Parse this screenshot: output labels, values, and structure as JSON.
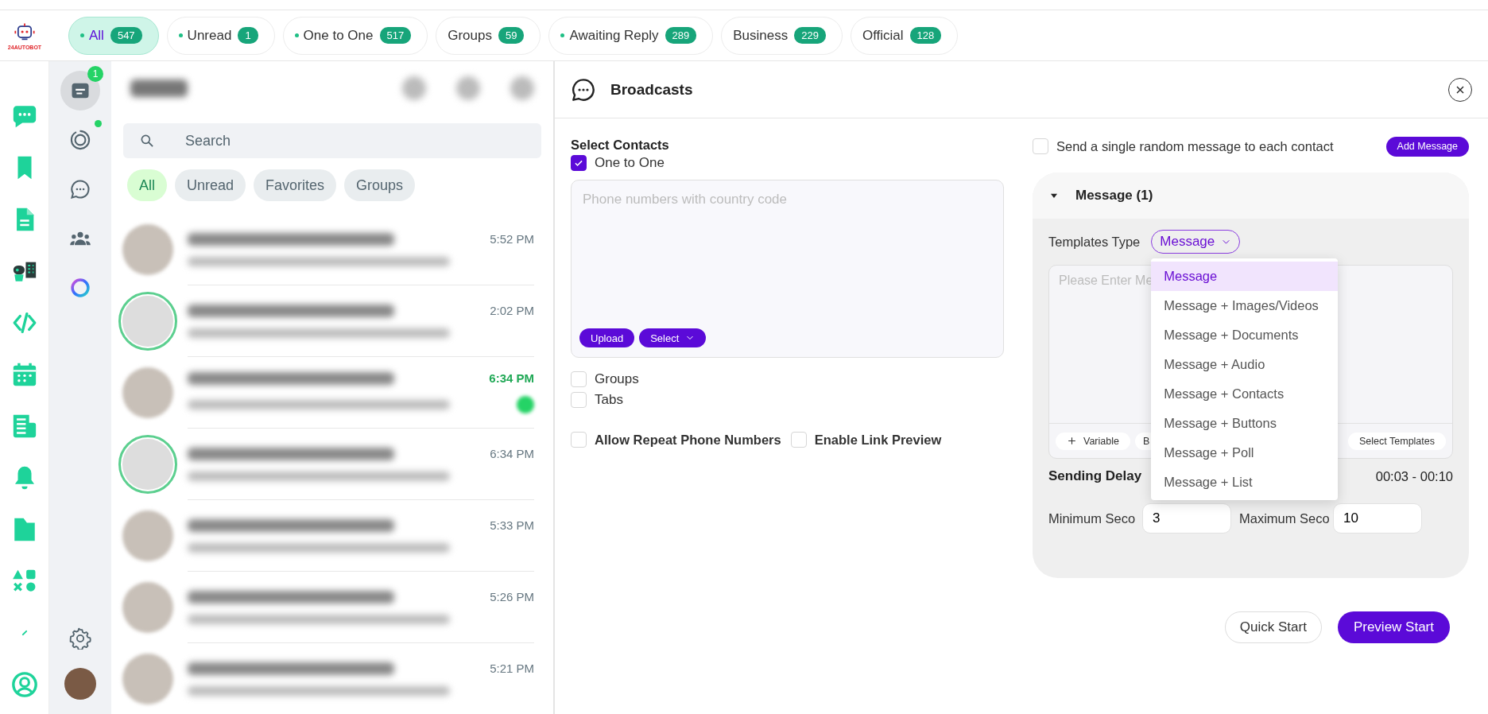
{
  "logo": {
    "text": "24AUTOBOT"
  },
  "filter_tabs": [
    {
      "label": "All",
      "count": "547",
      "dot": true,
      "selected": true
    },
    {
      "label": "Unread",
      "count": "1",
      "dot": true,
      "selected": false
    },
    {
      "label": "One to One",
      "count": "517",
      "dot": true,
      "selected": false
    },
    {
      "label": "Groups",
      "count": "59",
      "dot": false,
      "selected": false
    },
    {
      "label": "Awaiting Reply",
      "count": "289",
      "dot": true,
      "selected": false
    },
    {
      "label": "Business",
      "count": "229",
      "dot": false,
      "selected": false
    },
    {
      "label": "Official",
      "count": "128",
      "dot": false,
      "selected": false
    }
  ],
  "nav_rail": [
    {
      "kind": "chat"
    },
    {
      "kind": "bookmark"
    },
    {
      "kind": "document"
    },
    {
      "kind": "robot"
    },
    {
      "kind": "code"
    },
    {
      "kind": "calendar"
    },
    {
      "kind": "newspaper"
    },
    {
      "kind": "bell"
    },
    {
      "kind": "folder"
    },
    {
      "kind": "shapes"
    },
    {
      "kind": "slash"
    },
    {
      "kind": "user"
    }
  ],
  "side_rail": {
    "items": [
      {
        "kind": "chats",
        "selected": true,
        "dot": false,
        "badge": "1"
      },
      {
        "kind": "status",
        "selected": false,
        "dot": true
      },
      {
        "kind": "channels",
        "selected": false,
        "dot": false
      },
      {
        "kind": "communities",
        "selected": false,
        "dot": false
      },
      {
        "kind": "ai",
        "selected": false,
        "dot": false
      }
    ],
    "bottom": [
      {
        "kind": "settings"
      },
      {
        "kind": "profile"
      }
    ]
  },
  "chat_list": {
    "search": {
      "placeholder": "Search"
    },
    "chips": [
      {
        "label": "All",
        "selected": true
      },
      {
        "label": "Unread",
        "selected": false
      },
      {
        "label": "Favorites",
        "selected": false
      },
      {
        "label": "Groups",
        "selected": false
      }
    ],
    "rows": [
      {
        "time": "5:52 PM",
        "unread": false,
        "status_ring": false
      },
      {
        "time": "2:02 PM",
        "unread": false,
        "status_ring": true
      },
      {
        "time": "6:34 PM",
        "unread": true,
        "status_ring": false
      },
      {
        "time": "6:34 PM",
        "unread": false,
        "status_ring": true
      },
      {
        "time": "5:33 PM",
        "unread": false,
        "status_ring": false
      },
      {
        "time": "5:26 PM",
        "unread": false,
        "status_ring": false
      },
      {
        "time": "5:21 PM",
        "unread": false,
        "status_ring": false
      }
    ]
  },
  "broadcast": {
    "title": "Broadcasts",
    "contacts": {
      "heading": "Select Contacts",
      "one_to_one": {
        "label": "One to One",
        "checked": true
      },
      "phone_field": {
        "placeholder": "Phone numbers with country code"
      },
      "buttons": {
        "upload": "Upload",
        "select": "Select"
      },
      "others": [
        {
          "label": "Groups",
          "checked": false
        },
        {
          "label": "Tabs",
          "checked": false
        }
      ],
      "options": [
        {
          "label": "Allow Repeat Phone Numbers",
          "checked": false
        },
        {
          "label": "Enable Link Preview",
          "checked": false
        }
      ]
    },
    "random_message": {
      "label": "Send a single random message to each contact",
      "checked": false
    },
    "add_message": "Add Message",
    "message": {
      "title": "Message (1)",
      "expanded": true,
      "templates_type": {
        "label": "Templates Type",
        "value": "Message"
      },
      "dropdown": [
        {
          "label": "Message",
          "selected": true
        },
        {
          "label": "Message + Images/Videos",
          "selected": false
        },
        {
          "label": "Message + Documents",
          "selected": false
        },
        {
          "label": "Message + Audio",
          "selected": false
        },
        {
          "label": "Message + Contacts",
          "selected": false
        },
        {
          "label": "Message + Buttons",
          "selected": false
        },
        {
          "label": "Message + Poll",
          "selected": false
        },
        {
          "label": "Message + List",
          "selected": false
        }
      ],
      "text_field": {
        "placeholder": "Please Enter Me"
      },
      "toolbar": {
        "variable": "Variable",
        "bold": "B",
        "templates": "Select Templates"
      },
      "sending_delay": {
        "label": "Sending Delay",
        "range": "00:03 - 00:10"
      },
      "minimum": {
        "label": "Minimum Seco",
        "value": "3"
      },
      "maximum": {
        "label": "Maximum Seco",
        "value": "10"
      }
    },
    "footer": {
      "quick_start": "Quick Start",
      "preview_start": "Preview Start"
    }
  }
}
